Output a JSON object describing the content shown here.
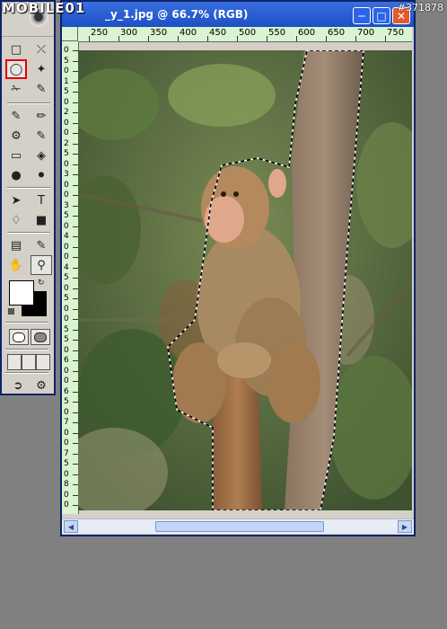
{
  "watermark": {
    "brand": "MOBILE01",
    "id": "#371878"
  },
  "document": {
    "title": "_y_1.jpg @ 66.7% (RGB)"
  },
  "ruler": {
    "h_labels": [
      "250",
      "300",
      "350",
      "400",
      "450",
      "500",
      "550",
      "600",
      "650",
      "700",
      "750"
    ],
    "v_labels": [
      "0",
      "5",
      "0",
      "1",
      "5",
      "0",
      "2",
      "0",
      "0",
      "2",
      "5",
      "0",
      "3",
      "0",
      "0",
      "3",
      "5",
      "0",
      "4",
      "0",
      "0",
      "4",
      "5",
      "0",
      "5",
      "0",
      "0",
      "5",
      "5",
      "0",
      "6",
      "0",
      "0",
      "6",
      "5",
      "0",
      "7",
      "0",
      "0",
      "7",
      "5",
      "0",
      "8",
      "0",
      "0"
    ]
  },
  "tools": {
    "selected": "lasso-tool"
  },
  "colors": {
    "foreground": "#ffffff",
    "background": "#000000"
  }
}
